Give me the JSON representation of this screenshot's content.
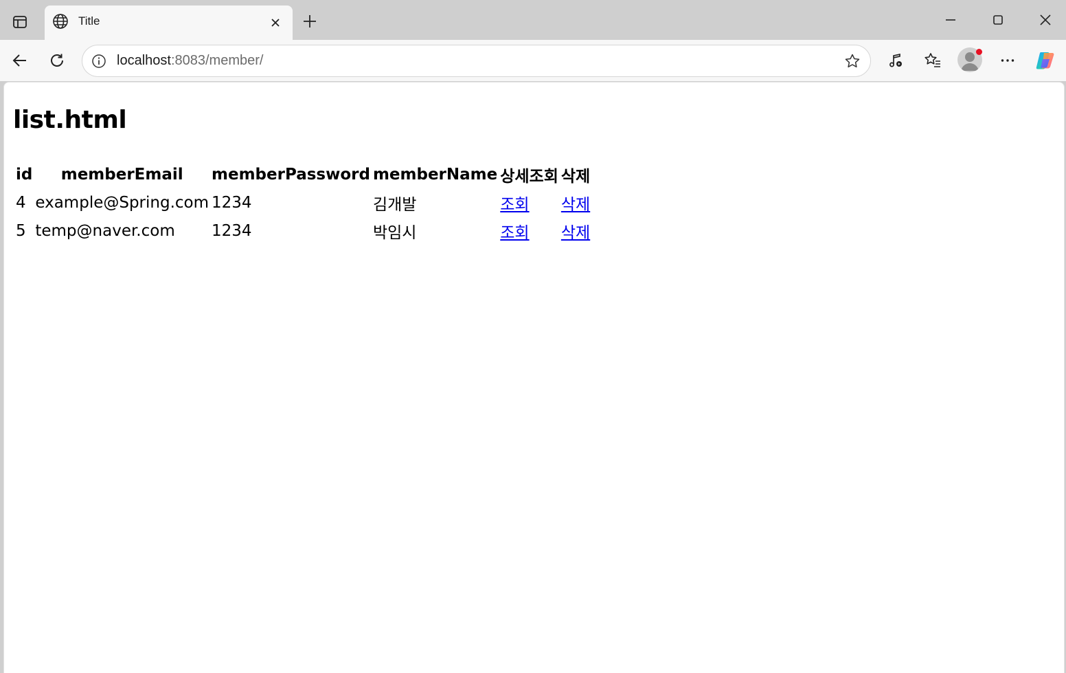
{
  "browser": {
    "tab": {
      "title": "Title"
    },
    "address": {
      "host": "localhost",
      "rest": ":8083/member/"
    },
    "icons": {
      "sidebar": "sidebar-toggle-icon",
      "favicon": "globe-icon",
      "close_tab": "close-icon",
      "new_tab": "plus-icon",
      "minimize": "minimize-icon",
      "maximize": "maximize-icon",
      "close_window": "close-icon",
      "back": "back-arrow-icon",
      "refresh": "refresh-icon",
      "site_info": "info-icon",
      "favorite": "star-icon",
      "media": "music-note-icon",
      "favorites_list": "favorites-icon",
      "profile": "avatar",
      "more": "more-icon",
      "copilot": "copilot-icon"
    },
    "colors": {
      "link": "#0000ee",
      "notification_dot": "#e81123"
    }
  },
  "page": {
    "title": "list.html",
    "table": {
      "headers": [
        "id",
        "memberEmail",
        "memberPassword",
        "memberName",
        "상세조회",
        "삭제"
      ],
      "rows": [
        {
          "id": "4",
          "email": "example@Spring.com",
          "password": "1234",
          "name": "김개발",
          "detail": "조회",
          "delete": "삭제"
        },
        {
          "id": "5",
          "email": "temp@naver.com",
          "password": "1234",
          "name": "박임시",
          "detail": "조회",
          "delete": "삭제"
        }
      ]
    }
  }
}
